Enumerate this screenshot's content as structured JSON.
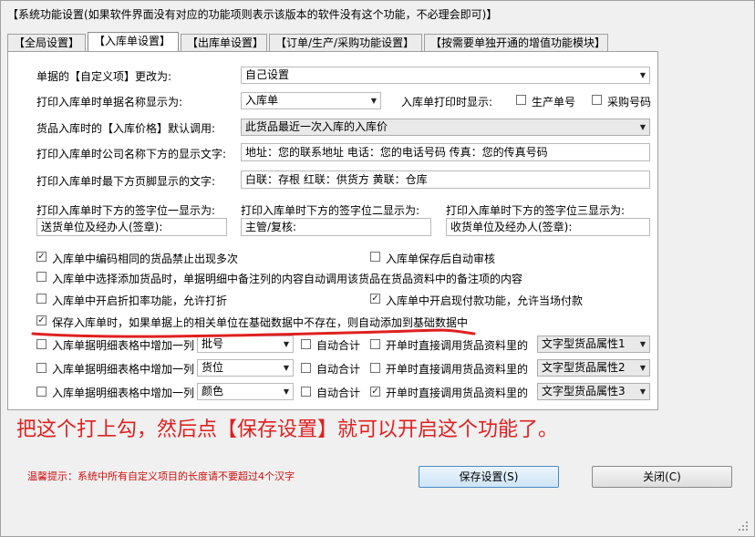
{
  "window": {
    "title": "【系统功能设置(如果软件界面没有对应的功能项则表示该版本的软件没有这个功能，不必理会即可)】"
  },
  "tabs": [
    {
      "label": "【全局设置】"
    },
    {
      "label": "【入库单设置】"
    },
    {
      "label": "【出库单设置】"
    },
    {
      "label": "【订单/生产/采购功能设置】"
    },
    {
      "label": "【按需要单独开通的增值功能模块】"
    }
  ],
  "form": {
    "custom_label": "单据的【自定义项】更改为:",
    "custom_value": "自己设置",
    "print_name_label": "打印入库单时单据名称显示为:",
    "print_name_value": "入库单",
    "print_show_label": "入库单打印时显示:",
    "prod_no_label": "生产单号",
    "purchase_no_label": "采购号码",
    "price_label": "货品入库时的【入库价格】默认调用:",
    "price_value": "此货品最近一次入库的入库价",
    "company_label": "打印入库单时公司名称下方的显示文字:",
    "company_value": "地址：您的联系地址 电话：您的电话号码 传真：您的传真号码",
    "footer_label": "打印入库单时最下方页脚显示的文字:",
    "footer_value": "白联：存根   红联：供货方   黄联：仓库",
    "sign1_label": "打印入库单时下方的签字位一显示为:",
    "sign1_value": "送货单位及经办人(签章):",
    "sign2_label": "打印入库单时下方的签字位二显示为:",
    "sign2_value": "主管/复核:",
    "sign3_label": "打印入库单时下方的签字位三显示为:",
    "sign3_value": "收货单位及经办人(签章):"
  },
  "options": [
    {
      "label": "入库单中编码相同的货品禁止出现多次",
      "checked": true
    },
    {
      "label": "入库单保存后自动审核",
      "checked": false
    },
    {
      "label": "入库单中选择添加货品时，单据明细中备注列的内容自动调用该货品在货品资料中的备注项的内容",
      "checked": false
    },
    {
      "label": "入库单中开启折扣率功能，允许打折",
      "checked": false
    },
    {
      "label": "入库单中开启现付款功能，允许当场付款",
      "checked": true
    },
    {
      "label": "保存入库单时，如果单据上的相关单位在基础数据中不存在，则自动添加到基础数据中",
      "checked": true
    }
  ],
  "column_rows": [
    {
      "add_label": "入库单据明细表格中增加一列",
      "column": "批号",
      "auto_sum": "自动合计",
      "open_label": "开单时直接调用货品资料里的",
      "attr": "文字型货品属性1",
      "checked": false,
      "auto_sum_checked": false,
      "open_checked": false
    },
    {
      "add_label": "入库单据明细表格中增加一列",
      "column": "货位",
      "auto_sum": "自动合计",
      "open_label": "开单时直接调用货品资料里的",
      "attr": "文字型货品属性2",
      "checked": false,
      "auto_sum_checked": false,
      "open_checked": false
    },
    {
      "add_label": "入库单据明细表格中增加一列",
      "column": "颜色",
      "auto_sum": "自动合计",
      "open_label": "开单时直接调用货品资料里的",
      "attr": "文字型货品属性3",
      "checked": false,
      "auto_sum_checked": false,
      "open_checked": true
    }
  ],
  "annotation": "把这个打上勾，然后点【保存设置】就可以开启这个功能了。",
  "hint": "温馨提示：系统中所有自定义项目的长度请不要超过4个汉字",
  "buttons": {
    "save": "保存设置(S)",
    "close": "关闭(C)"
  },
  "colors": {
    "annotation": "#e02020",
    "hint": "#d01010",
    "underline": "#e02020"
  }
}
